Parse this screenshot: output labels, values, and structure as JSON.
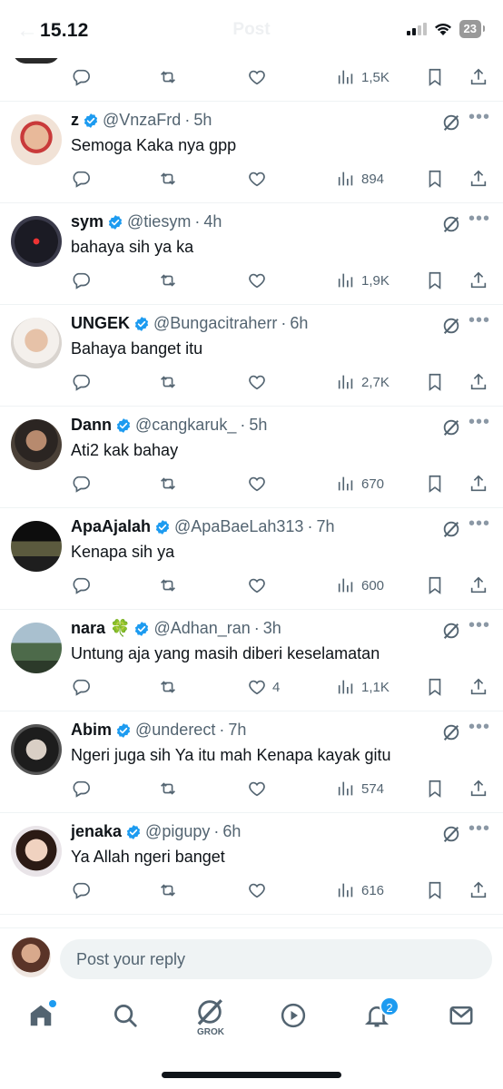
{
  "status_bar": {
    "time": "15.12",
    "battery": "23"
  },
  "header": {
    "title": "Post"
  },
  "top_partial": {
    "views": "1,5K"
  },
  "tweets": [
    {
      "name": "z",
      "handle": "@VnzaFrd",
      "time": "5h",
      "text": "Semoga Kaka nya gpp",
      "likes": "",
      "views": "894"
    },
    {
      "name": "sym",
      "handle": "@tiesym",
      "time": "4h",
      "text": "bahaya sih ya ka",
      "likes": "",
      "views": "1,9K"
    },
    {
      "name": "UNGEK",
      "handle": "@Bungacitraherr",
      "time": "6h",
      "text": "Bahaya banget itu",
      "likes": "",
      "views": "2,7K"
    },
    {
      "name": "Dann",
      "handle": "@cangkaruk_",
      "time": "5h",
      "text": "Ati2 kak bahay",
      "likes": "",
      "views": "670"
    },
    {
      "name": "ApaAjalah",
      "handle": "@ApaBaeLah313",
      "time": "7h",
      "text": "Kenapa sih ya",
      "likes": "",
      "views": "600"
    },
    {
      "name": "nara 🍀",
      "handle": "@Adhan_ran",
      "time": "3h",
      "text": "Untung aja yang masih diberi keselamatan",
      "likes": "4",
      "views": "1,1K"
    },
    {
      "name": "Abim",
      "handle": "@underect",
      "time": "7h",
      "text": "Ngeri juga sih Ya itu mah Kenapa kayak gitu",
      "likes": "",
      "views": "574"
    },
    {
      "name": "jenaka",
      "handle": "@pigupy",
      "time": "6h",
      "text": "Ya Allah ngeri banget",
      "likes": "",
      "views": "616"
    }
  ],
  "reply": {
    "placeholder": "Post your reply"
  },
  "tabbar": {
    "grok_label": "GROK",
    "notifications_badge": "2"
  },
  "colors": {
    "accent": "#1d9bf0",
    "text": "#0f1419",
    "muted": "#536471",
    "divider": "#eff3f4"
  },
  "icons": [
    "reply-icon",
    "retweet-icon",
    "like-icon",
    "views-icon",
    "bookmark-icon",
    "share-icon",
    "grok-icon",
    "more-icon",
    "verified-icon",
    "home-icon",
    "search-icon",
    "video-icon",
    "bell-icon",
    "mail-icon"
  ]
}
